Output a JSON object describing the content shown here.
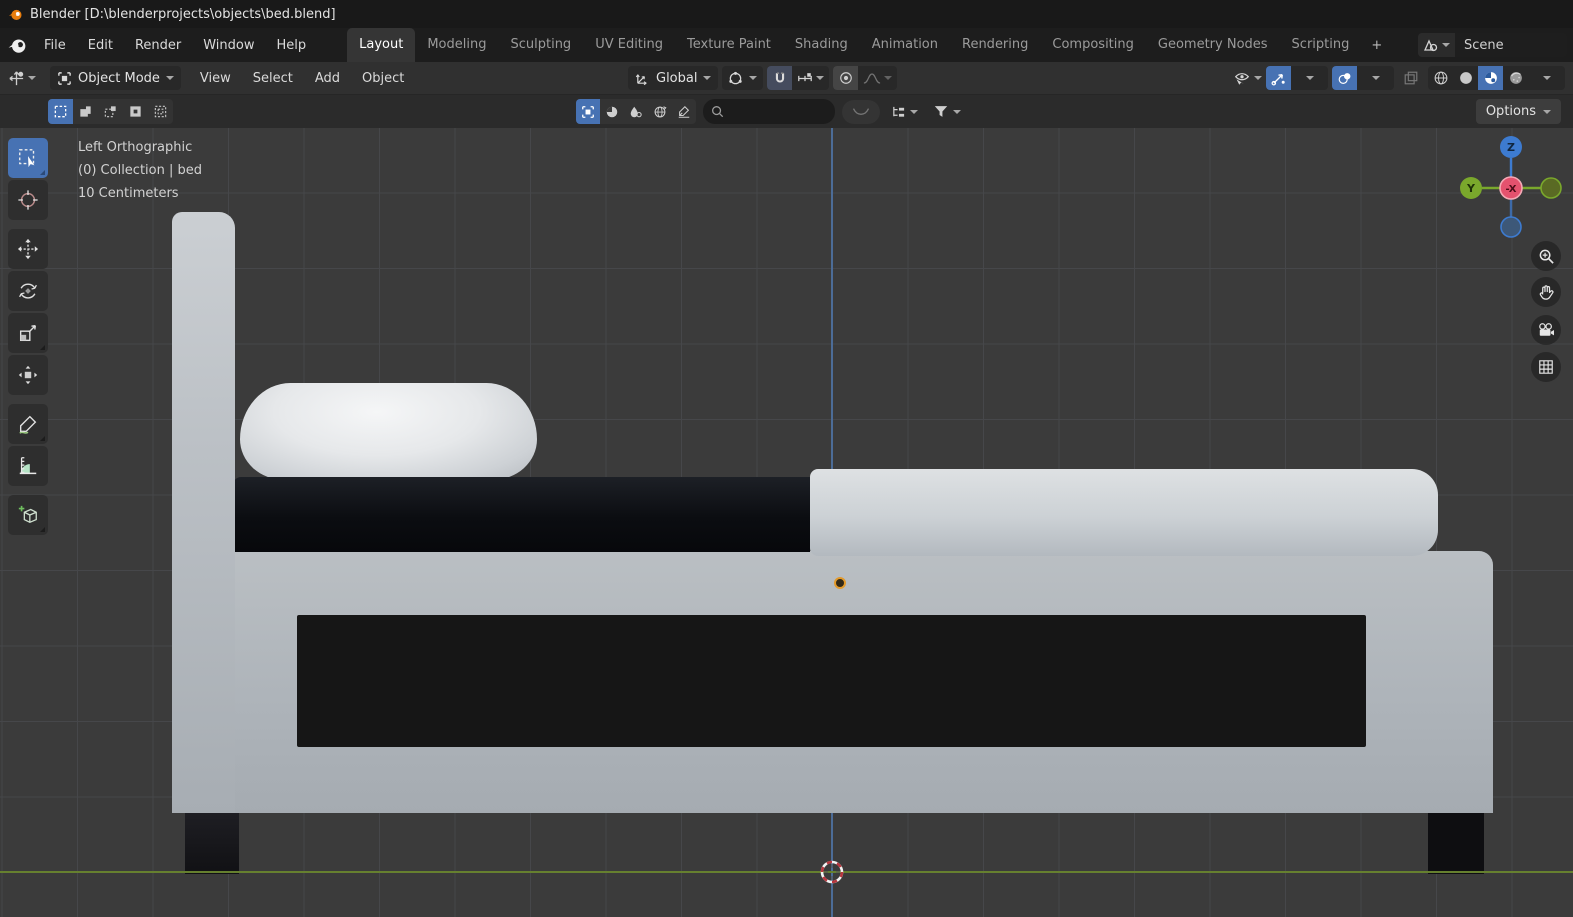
{
  "window": {
    "title": "Blender [D:\\blenderprojects\\objects\\bed.blend]"
  },
  "menubar": {
    "items": [
      "File",
      "Edit",
      "Render",
      "Window",
      "Help"
    ]
  },
  "workspaces": {
    "tabs": [
      "Layout",
      "Modeling",
      "Sculpting",
      "UV Editing",
      "Texture Paint",
      "Shading",
      "Animation",
      "Rendering",
      "Compositing",
      "Geometry Nodes",
      "Scripting"
    ],
    "active": "Layout",
    "add_label": "+"
  },
  "scene": {
    "value": "Scene"
  },
  "viewport_header": {
    "mode_label": "Object Mode",
    "menus": [
      "View",
      "Select",
      "Add",
      "Object"
    ],
    "orientation_label": "Global"
  },
  "tool_settings": {
    "options_label": "Options",
    "search_value": "",
    "search_placeholder": ""
  },
  "viewport": {
    "view_label": "Left Orthographic",
    "collection_label": "(0) Collection | bed",
    "scale_label": "10 Centimeters",
    "gizmo": {
      "z_label": "Z",
      "y_label": "Y",
      "center_label": "-X"
    }
  },
  "icons": {
    "blender-logo": "orange swirl",
    "search": "magnifier",
    "snap": "magnet",
    "filter": "funnel",
    "zoom": "magnifier-plus",
    "pan": "hand",
    "camera-view": "movie camera",
    "ortho-toggle": "grid"
  },
  "colors": {
    "accent_blue": "#4772b3",
    "axis_z_blue": "#4c6c97",
    "axis_y_green": "#66802f",
    "gizmo_z": "#3d7bd0",
    "gizmo_y": "#7aa82c",
    "gizmo_x_neg": "#e4526e",
    "origin_orange": "#e39b2d",
    "viewport_bg": "#3b3b3b"
  }
}
